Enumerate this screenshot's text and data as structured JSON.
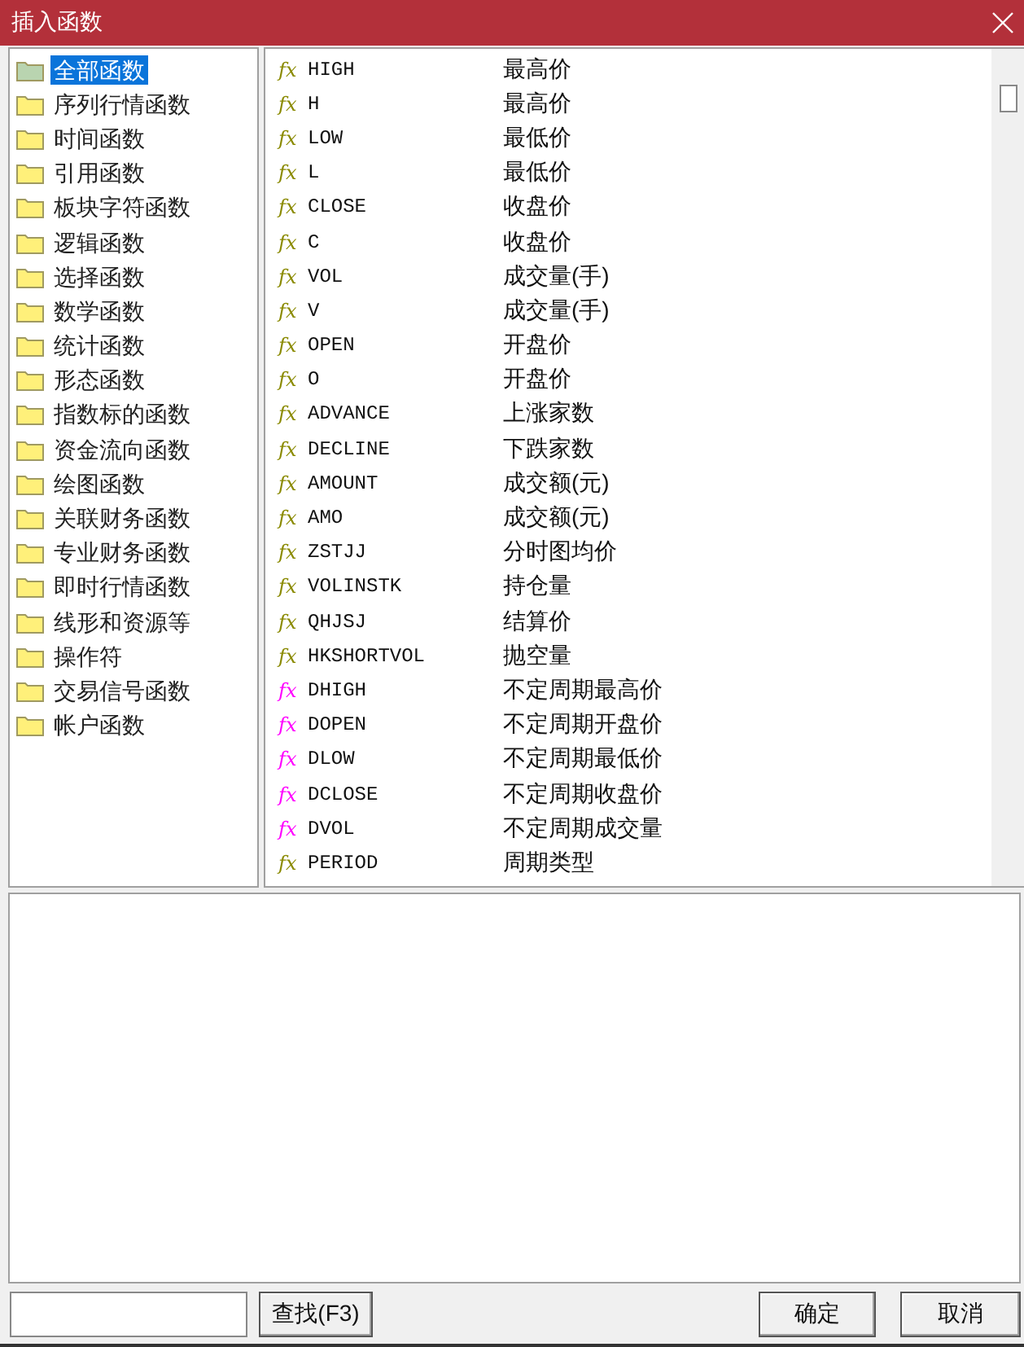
{
  "window": {
    "title": "插入函数"
  },
  "categories": [
    {
      "label": "全部函数",
      "selected": true
    },
    {
      "label": "序列行情函数",
      "selected": false
    },
    {
      "label": "时间函数",
      "selected": false
    },
    {
      "label": "引用函数",
      "selected": false
    },
    {
      "label": "板块字符函数",
      "selected": false
    },
    {
      "label": "逻辑函数",
      "selected": false
    },
    {
      "label": "选择函数",
      "selected": false
    },
    {
      "label": "数学函数",
      "selected": false
    },
    {
      "label": "统计函数",
      "selected": false
    },
    {
      "label": "形态函数",
      "selected": false
    },
    {
      "label": "指数标的函数",
      "selected": false
    },
    {
      "label": "资金流向函数",
      "selected": false
    },
    {
      "label": "绘图函数",
      "selected": false
    },
    {
      "label": "关联财务函数",
      "selected": false
    },
    {
      "label": "专业财务函数",
      "selected": false
    },
    {
      "label": "即时行情函数",
      "selected": false
    },
    {
      "label": "线形和资源等",
      "selected": false
    },
    {
      "label": "操作符",
      "selected": false
    },
    {
      "label": "交易信号函数",
      "selected": false
    },
    {
      "label": "帐户函数",
      "selected": false
    }
  ],
  "functions": [
    {
      "icon": "fx",
      "color": "#8a8a00",
      "name": "HIGH",
      "description": "最高价"
    },
    {
      "icon": "fx",
      "color": "#8a8a00",
      "name": "H",
      "description": "最高价"
    },
    {
      "icon": "fx",
      "color": "#8a8a00",
      "name": "LOW",
      "description": "最低价"
    },
    {
      "icon": "fx",
      "color": "#8a8a00",
      "name": "L",
      "description": "最低价"
    },
    {
      "icon": "fx",
      "color": "#8a8a00",
      "name": "CLOSE",
      "description": "收盘价"
    },
    {
      "icon": "fx",
      "color": "#8a8a00",
      "name": "C",
      "description": "收盘价"
    },
    {
      "icon": "fx",
      "color": "#8a8a00",
      "name": "VOL",
      "description": "成交量(手)"
    },
    {
      "icon": "fx",
      "color": "#8a8a00",
      "name": "V",
      "description": "成交量(手)"
    },
    {
      "icon": "fx",
      "color": "#8a8a00",
      "name": "OPEN",
      "description": "开盘价"
    },
    {
      "icon": "fx",
      "color": "#8a8a00",
      "name": "O",
      "description": "开盘价"
    },
    {
      "icon": "fx",
      "color": "#8a8a00",
      "name": "ADVANCE",
      "description": "上涨家数"
    },
    {
      "icon": "fx",
      "color": "#8a8a00",
      "name": "DECLINE",
      "description": "下跌家数"
    },
    {
      "icon": "fx",
      "color": "#8a8a00",
      "name": "AMOUNT",
      "description": "成交额(元)"
    },
    {
      "icon": "fx",
      "color": "#8a8a00",
      "name": "AMO",
      "description": "成交额(元)"
    },
    {
      "icon": "fx",
      "color": "#8a8a00",
      "name": "ZSTJJ",
      "description": "分时图均价"
    },
    {
      "icon": "fx",
      "color": "#8a8a00",
      "name": "VOLINSTK",
      "description": "持仓量"
    },
    {
      "icon": "fx",
      "color": "#8a8a00",
      "name": "QHJSJ",
      "description": "结算价"
    },
    {
      "icon": "fx",
      "color": "#8a8a00",
      "name": "HKSHORTVOL",
      "description": "抛空量"
    },
    {
      "icon": "fx",
      "color": "#ff00ff",
      "name": "DHIGH",
      "description": "不定周期最高价"
    },
    {
      "icon": "fx",
      "color": "#ff00ff",
      "name": "DOPEN",
      "description": "不定周期开盘价"
    },
    {
      "icon": "fx",
      "color": "#ff00ff",
      "name": "DLOW",
      "description": "不定周期最低价"
    },
    {
      "icon": "fx",
      "color": "#ff00ff",
      "name": "DCLOSE",
      "description": "不定周期收盘价"
    },
    {
      "icon": "fx",
      "color": "#ff00ff",
      "name": "DVOL",
      "description": "不定周期成交量"
    },
    {
      "icon": "fx",
      "color": "#8a8a00",
      "name": "PERIOD",
      "description": "周期类型"
    }
  ],
  "buttons": [
    {
      "kind": "find",
      "label": "查找(F3)"
    },
    {
      "kind": "ok",
      "label": "确定"
    },
    {
      "kind": "cancel",
      "label": "取消"
    }
  ]
}
